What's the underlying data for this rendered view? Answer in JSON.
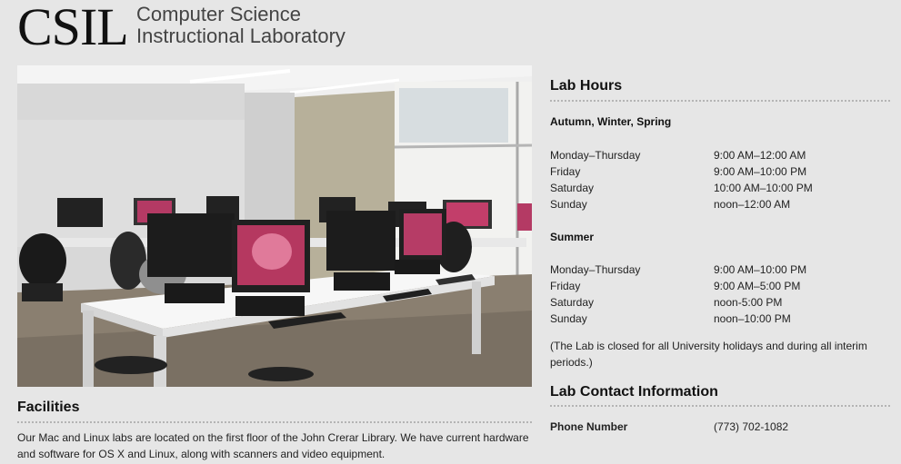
{
  "header": {
    "logo_text": "CSIL",
    "subtitle_line1": "Computer Science",
    "subtitle_line2": "Instructional Laboratory"
  },
  "facilities": {
    "title": "Facilities",
    "text_line1": "Our Mac and Linux labs are located on the first floor of the John Crerar Library. We have current hardware",
    "text_line2": "and software for OS X and Linux, along with scanners and video equipment."
  },
  "lab_hours": {
    "title": "Lab Hours",
    "regular": {
      "heading": "Autumn, Winter, Spring",
      "rows": [
        {
          "day": "Monday–Thursday",
          "time": "9:00 AM–12:00 AM"
        },
        {
          "day": "Friday",
          "time": "9:00 AM–10:00 PM"
        },
        {
          "day": "Saturday",
          "time": "10:00 AM–10:00 PM"
        },
        {
          "day": "Sunday",
          "time": "noon–12:00 AM"
        }
      ]
    },
    "summer": {
      "heading": "Summer",
      "rows": [
        {
          "day": "Monday–Thursday",
          "time": "9:00 AM–10:00 PM"
        },
        {
          "day": "Friday",
          "time": "9:00 AM–5:00 PM"
        },
        {
          "day": "Saturday",
          "time": "noon-5:00 PM"
        },
        {
          "day": "Sunday",
          "time": "noon–10:00 PM"
        }
      ]
    },
    "note_line1": "(The Lab is closed for all University holidays and during all interim",
    "note_line2": "periods.)"
  },
  "contact": {
    "title": "Lab Contact Information",
    "phone_label": "Phone Number",
    "phone_value": "(773) 702-1082"
  }
}
